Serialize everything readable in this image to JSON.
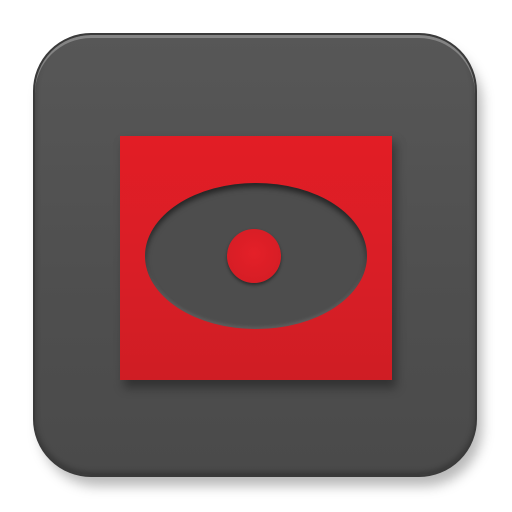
{
  "app_icon": {
    "icon": "eye-icon",
    "colors": {
      "tile": "#515151",
      "tile_border": "#3a3a3a",
      "accent_red": "#dd1f27",
      "eye_dark": "#4d4d4d"
    }
  }
}
